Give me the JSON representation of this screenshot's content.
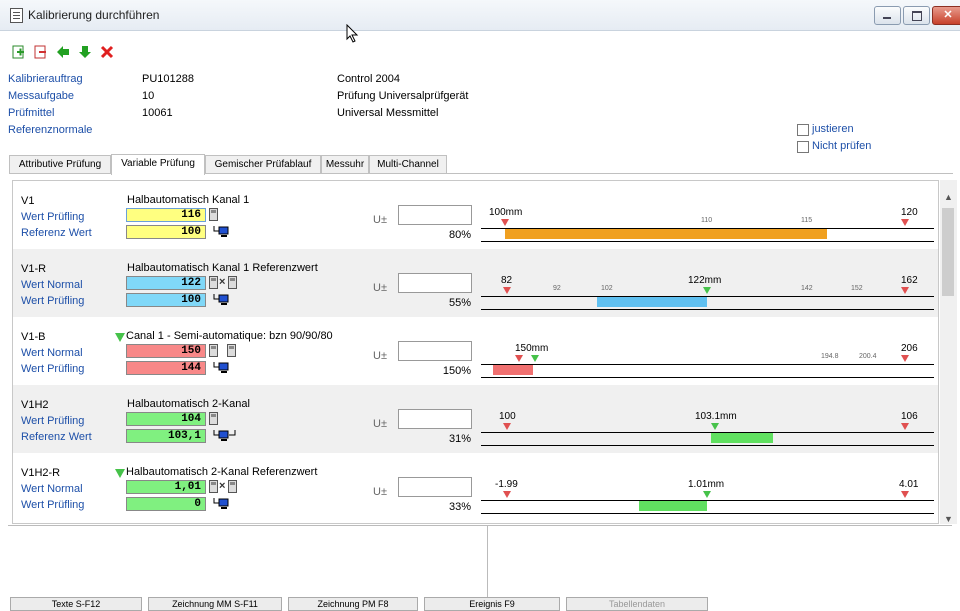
{
  "window": {
    "title": "Kalibrierung durchführen"
  },
  "header": {
    "fields": [
      {
        "label": "Kalibrierauftrag",
        "value": "PU101288",
        "extra": "Control 2004"
      },
      {
        "label": "Messaufgabe",
        "value": "10",
        "extra": "Prüfung Universalprüfgerät"
      },
      {
        "label": "Prüfmittel",
        "value": "10061",
        "extra": "Universal Messmittel"
      },
      {
        "label": "Referenznormale",
        "value": "",
        "extra": ""
      }
    ],
    "checkboxes": [
      {
        "label": "justieren",
        "checked": false
      },
      {
        "label": "Nicht prüfen",
        "checked": false
      }
    ]
  },
  "tabs": [
    "Attributive Prüfung",
    "Variable Prüfung",
    "Gemischer Prüfablauf",
    "Messuhr",
    "Multi-Channel"
  ],
  "active_tab": "Variable Prüfung",
  "rows": [
    {
      "code": "V1",
      "desc": "Halbautomatisch Kanal 1",
      "label1": "Wert Prüfling",
      "label2": "Referenz Wert",
      "val1": "116",
      "val2": "100",
      "color": "#ffff80",
      "upm": "U±",
      "pct": "80%",
      "scale": {
        "left": "100mm",
        "right": "120",
        "ticks": [
          "110",
          "115"
        ],
        "bar_color": "#f0a020"
      }
    },
    {
      "code": "V1-R",
      "desc": "Halbautomatisch Kanal 1 Referenzwert",
      "label1": "Wert Normal",
      "label2": "Wert Prüfling",
      "val1": "122",
      "val2": "100",
      "color": "#80d8f8",
      "upm": "U±",
      "pct": "55%",
      "scale": {
        "left": "82",
        "right": "162",
        "center": "122mm",
        "ticks": [
          "92",
          "102",
          "142",
          "152"
        ],
        "bar_color": "#60c0f0"
      }
    },
    {
      "code": "V1-B",
      "desc": "Canal 1 - Semi-automatique: bzn 90/90/80",
      "label1": "Wert Normal",
      "label2": "Wert Prüfling",
      "val1": "150",
      "val2": "144",
      "color": "#f88888",
      "upm": "U±",
      "pct": "150%",
      "scale": {
        "left": "",
        "right": "206",
        "center": "150mm",
        "ticks": [
          "194.8",
          "200.4"
        ],
        "bar_color": "#f07070"
      }
    },
    {
      "code": "V1H2",
      "desc": "Halbautomatisch 2-Kanal",
      "label1": "Wert Prüfling",
      "label2": "Referenz Wert",
      "val1": "104",
      "val2": "103,1",
      "color": "#80f080",
      "upm": "U±",
      "pct": "31%",
      "scale": {
        "left": "100",
        "right": "106",
        "center": "103.1mm",
        "ticks": [],
        "bar_color": "#60e060"
      }
    },
    {
      "code": "V1H2-R",
      "desc": "Halbautomatisch 2-Kanal Referenzwert",
      "label1": "Wert Normal",
      "label2": "Wert Prüfling",
      "val1": "1,01",
      "val2": "0",
      "color": "#80f080",
      "upm": "U±",
      "pct": "33%",
      "scale": {
        "left": "-1.99",
        "right": "4.01",
        "center": "1.01mm",
        "ticks": [],
        "bar_color": "#60e060"
      }
    }
  ],
  "bottom_tabs": [
    {
      "label": "Texte S-F12",
      "enabled": true
    },
    {
      "label": "Zeichnung MM S-F11",
      "enabled": true
    },
    {
      "label": "Zeichnung PM F8",
      "enabled": true
    },
    {
      "label": "Ereignis F9",
      "enabled": true
    },
    {
      "label": "Tabellendaten",
      "enabled": false
    }
  ],
  "colors": {
    "label_blue": "#1d4fa8",
    "accent_green": "#46c24a",
    "accent_red": "#e05050"
  }
}
